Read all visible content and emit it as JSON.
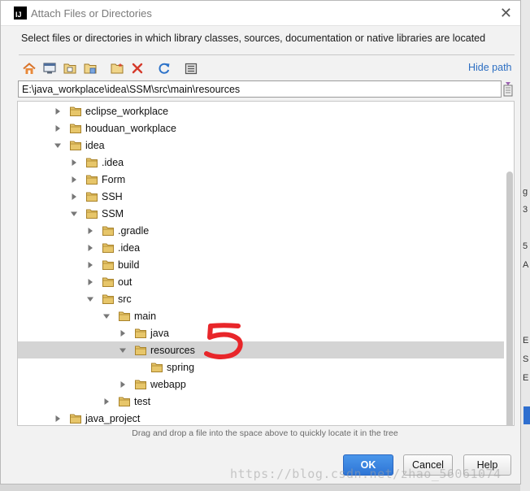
{
  "dialog": {
    "title": "Attach Files or Directories",
    "app_icon_text": "IJ",
    "description": "Select files or directories in which library classes, sources, documentation or native libraries are located"
  },
  "toolbar": {
    "icons": [
      "home-icon",
      "desktop-icon",
      "project-folder-icon",
      "module-folder-icon",
      "new-folder-icon",
      "delete-icon",
      "refresh-icon",
      "show-hidden-icon"
    ],
    "hide_path_label": "Hide path"
  },
  "path_field": {
    "value": "E:\\java_workplace\\idea\\SSM\\src\\main\\resources"
  },
  "tree": {
    "items": [
      {
        "label": "eclipse_workplace",
        "depth": 0,
        "state": "collapsed"
      },
      {
        "label": "houduan_workplace",
        "depth": 0,
        "state": "collapsed"
      },
      {
        "label": "idea",
        "depth": 0,
        "state": "expanded"
      },
      {
        "label": ".idea",
        "depth": 1,
        "state": "collapsed"
      },
      {
        "label": "Form",
        "depth": 1,
        "state": "collapsed"
      },
      {
        "label": "SSH",
        "depth": 1,
        "state": "collapsed"
      },
      {
        "label": "SSM",
        "depth": 1,
        "state": "expanded"
      },
      {
        "label": ".gradle",
        "depth": 2,
        "state": "collapsed"
      },
      {
        "label": ".idea",
        "depth": 2,
        "state": "collapsed"
      },
      {
        "label": "build",
        "depth": 2,
        "state": "collapsed"
      },
      {
        "label": "out",
        "depth": 2,
        "state": "collapsed"
      },
      {
        "label": "src",
        "depth": 2,
        "state": "expanded"
      },
      {
        "label": "main",
        "depth": 3,
        "state": "expanded"
      },
      {
        "label": "java",
        "depth": 4,
        "state": "collapsed"
      },
      {
        "label": "resources",
        "depth": 4,
        "state": "expanded",
        "selected": true
      },
      {
        "label": "spring",
        "depth": 5,
        "state": "leaf"
      },
      {
        "label": "webapp",
        "depth": 4,
        "state": "collapsed"
      },
      {
        "label": "test",
        "depth": 3,
        "state": "collapsed"
      },
      {
        "label": "java_project",
        "depth": 0,
        "state": "collapsed"
      }
    ]
  },
  "hint": "Drag and drop a file into the space above to quickly locate it in the tree",
  "buttons": {
    "ok": "OK",
    "cancel": "Cancel",
    "help": "Help"
  },
  "watermark": "https://blog.csdn.net/zhao_56061074",
  "background_chars": [
    "g",
    "3",
    "5",
    "A",
    "E",
    "S",
    "E"
  ],
  "colors": {
    "accent": "#2c6ec2",
    "ok_button": "#3b86e0",
    "selection": "#d4d4d4",
    "folder": "#e7c66a",
    "annotation": "#e8262a"
  }
}
